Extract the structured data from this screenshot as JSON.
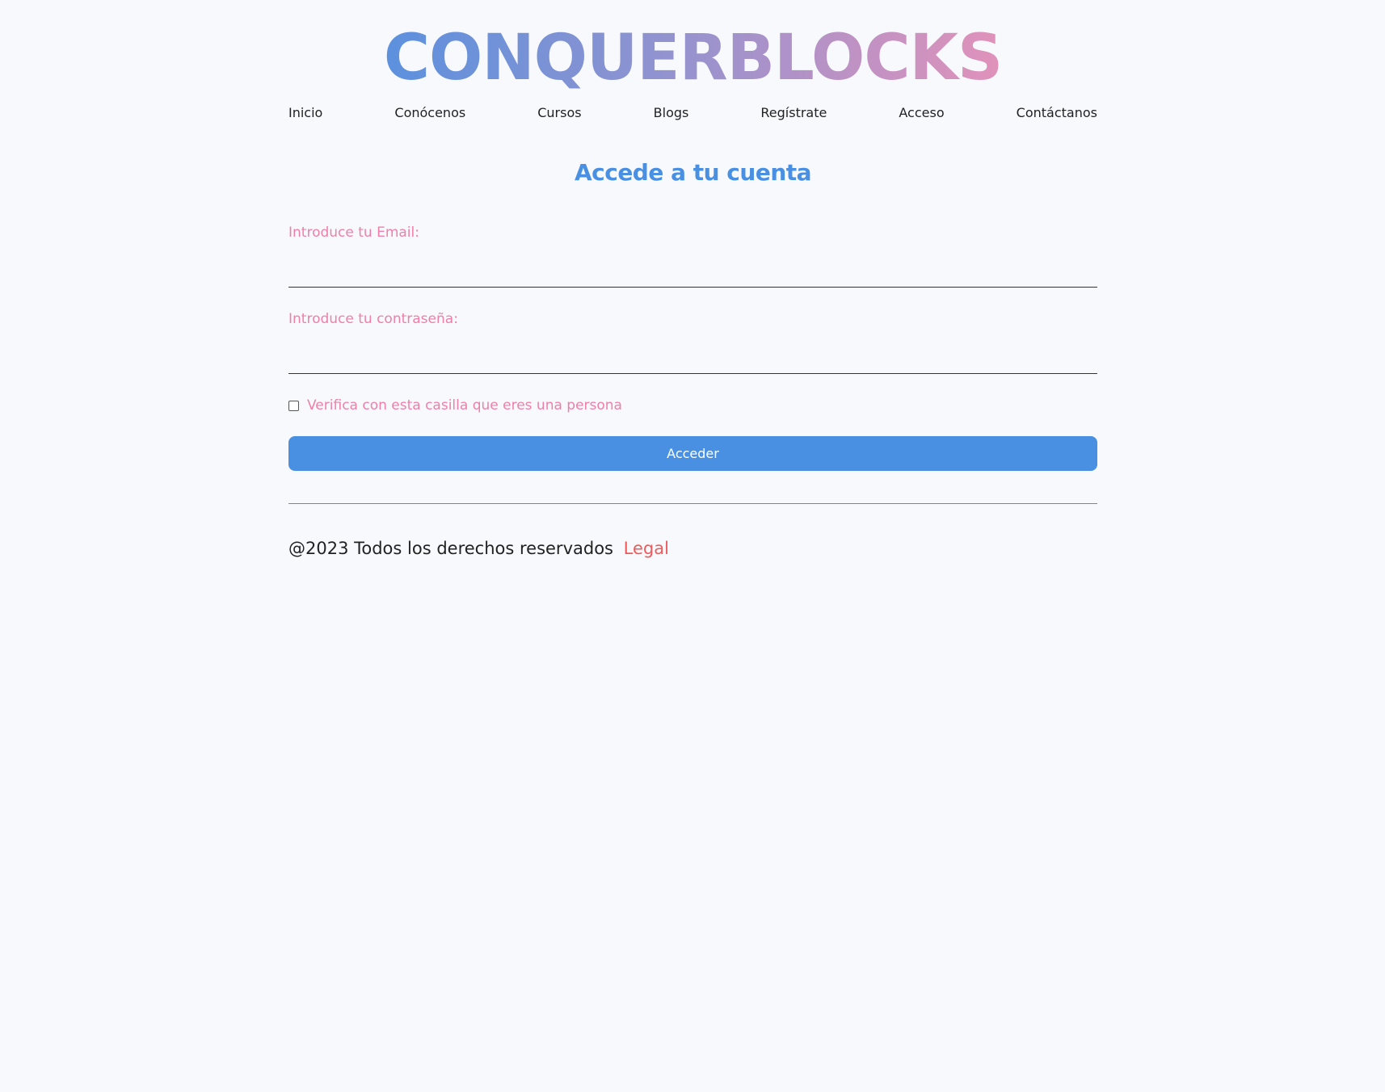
{
  "header": {
    "logo_text": "CONQUERBLOCKS",
    "gradient": {
      "start": "#4a90e2",
      "middle": "#8f93d0",
      "end": "#f791b4"
    }
  },
  "nav": {
    "items": [
      {
        "label": "Inicio"
      },
      {
        "label": "Conócenos"
      },
      {
        "label": "Cursos"
      },
      {
        "label": "Blogs"
      },
      {
        "label": "Regístrate"
      },
      {
        "label": "Acceso"
      },
      {
        "label": "Contáctanos"
      }
    ]
  },
  "login": {
    "title": "Accede a tu cuenta",
    "email_label": "Introduce tu Email:",
    "email_value": "",
    "password_label": "Introduce tu contraseña:",
    "password_value": "",
    "checkbox_label": "Verifica con esta casilla que eres una persona",
    "checkbox_checked": false,
    "submit_label": "Acceder"
  },
  "footer": {
    "copyright": "@2023 Todos los derechos reservados",
    "legal_link": "Legal"
  },
  "colors": {
    "accent": "#4a90e2",
    "label_pink": "#f07fa8",
    "legal_red": "#f05a5a",
    "background": "#f7f9fc"
  }
}
